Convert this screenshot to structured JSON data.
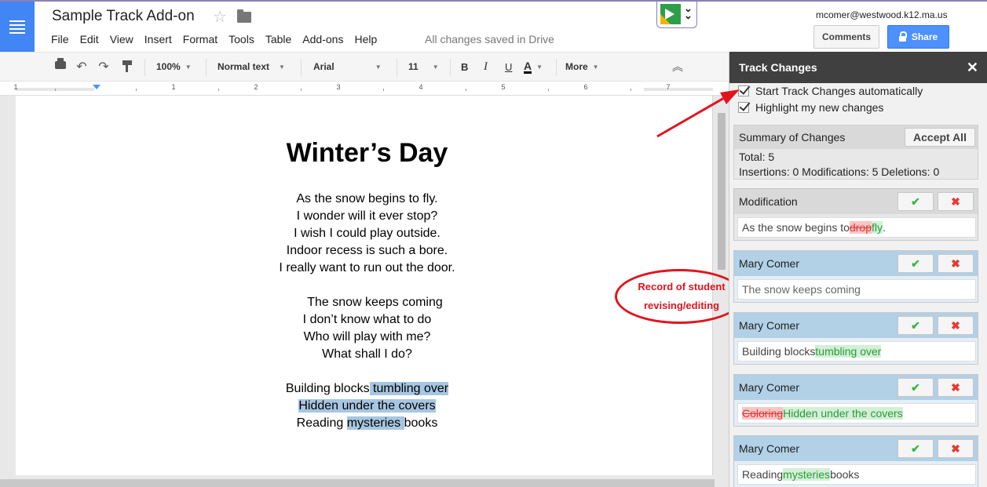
{
  "app": {
    "doc_title": "Sample Track Add-on",
    "save_status": "All changes saved in Drive",
    "user_email": "mcomer@westwood.k12.ma.us",
    "comments_label": "Comments",
    "share_label": "Share"
  },
  "menu": [
    "File",
    "Edit",
    "View",
    "Insert",
    "Format",
    "Tools",
    "Table",
    "Add-ons",
    "Help"
  ],
  "toolbar": {
    "zoom": "100%",
    "style": "Normal text",
    "font": "Arial",
    "size": "11",
    "bold": "B",
    "italic": "I",
    "underline": "U",
    "text_color": "A",
    "more": "More"
  },
  "ruler": {
    "numbers": [
      "1",
      "1",
      "2",
      "3",
      "4",
      "5",
      "6",
      "7"
    ]
  },
  "document": {
    "title": "Winter’s Day",
    "stanza1": [
      "As the snow begins to fly.",
      "I wonder will it ever stop?",
      "I wish I could play outside.",
      "Indoor recess is such a bore.",
      "I really want to run out the door."
    ],
    "stanza2": [
      "The snow keeps coming",
      "I don’t know what to do",
      "Who will play with me?",
      "What shall I do?"
    ],
    "stanza3": {
      "l1_a": "Building blocks",
      "l1_b": " tumbling over",
      "l2": "Hidden under the covers",
      "l3_a": "Reading ",
      "l3_b": "mysteries ",
      "l3_c": "books"
    }
  },
  "annotation": {
    "line1": "Record of student",
    "line2": "revising/editing",
    "color": "#e1141e"
  },
  "sidebar": {
    "title": "Track Changes",
    "close": "✕",
    "option1": "Start Track Changes automatically",
    "option2": "Highlight my new changes",
    "summary_title": "Summary of Changes",
    "accept_all": "Accept All",
    "total": "Total: 5",
    "breakdown": "Insertions: 0 Modifications: 5 Deletions: 0",
    "accept_symbol": "✔",
    "reject_symbol": "✖",
    "cards": [
      {
        "author": "Modification",
        "pre": "As the snow begins to ",
        "deleted": "drop",
        "inserted": "fly",
        "post": "."
      },
      {
        "author": "Mary Comer",
        "text": "The snow keeps coming"
      },
      {
        "author": "Mary Comer",
        "pre": "Building blocks",
        "inserted": " tumbling over"
      },
      {
        "author": "Mary Comer",
        "deleted": "Coloring",
        "inserted": "Hidden under the covers"
      },
      {
        "author": "Mary Comer",
        "pre": "Reading ",
        "inserted": "mysteries ",
        "post": "books"
      }
    ]
  },
  "colors": {
    "docs_blue": "#4285f4",
    "share_blue": "#4d90fe",
    "highlight": "#a7c6e1",
    "deleted": "#e53935",
    "inserted": "#2a9a3a"
  }
}
